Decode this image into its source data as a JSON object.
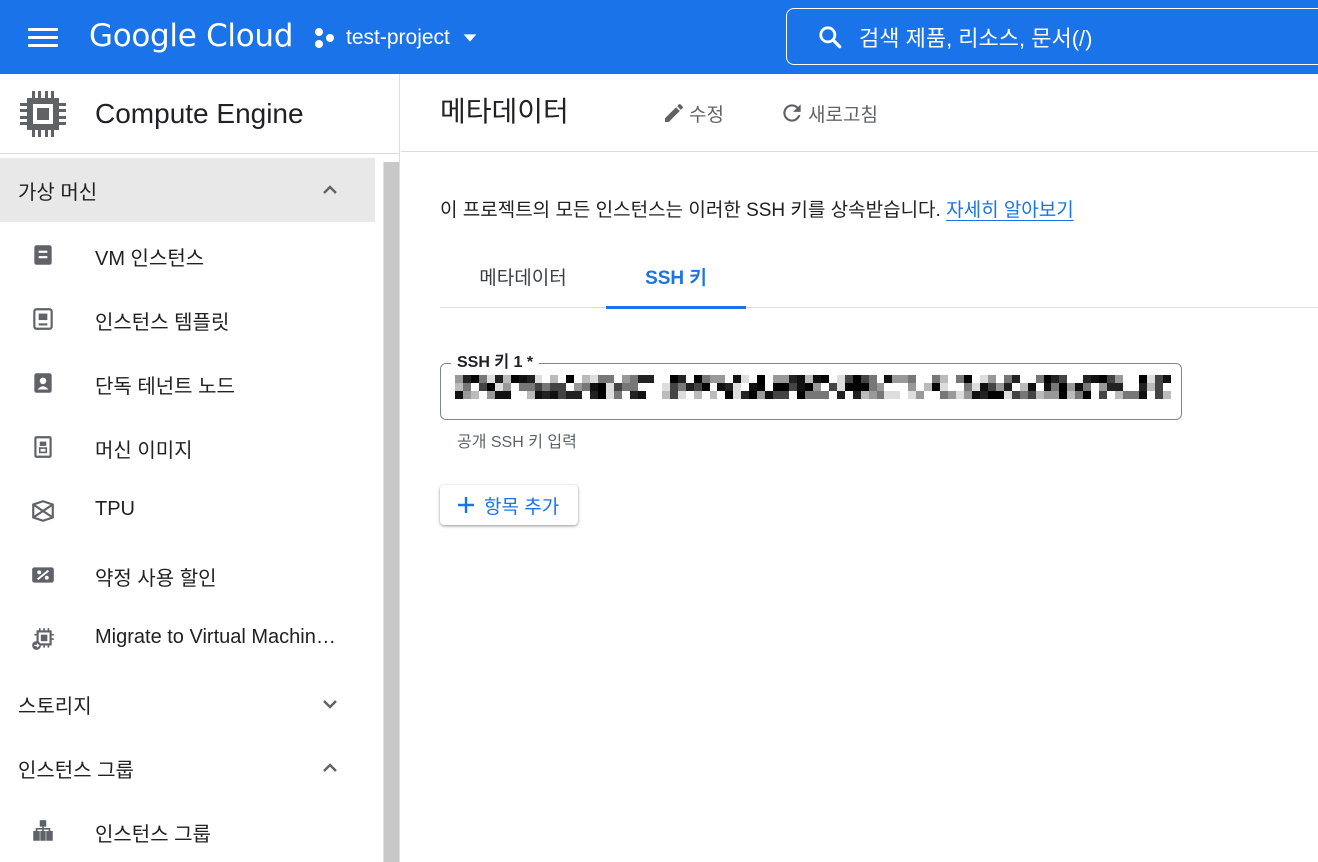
{
  "topbar": {
    "logo_text": "Google Cloud",
    "project_name": "test-project",
    "search_label": "검색   제품, 리소스, 문서(/)"
  },
  "sidebar": {
    "product_title": "Compute Engine",
    "sections": [
      {
        "label": "가상 머신",
        "expanded": true,
        "active": true
      },
      {
        "label": "스토리지",
        "expanded": false
      },
      {
        "label": "인스턴스 그룹",
        "expanded": true
      }
    ],
    "vm_items": [
      {
        "label": "VM 인스턴스",
        "icon": "server-icon"
      },
      {
        "label": "인스턴스 템플릿",
        "icon": "template-icon"
      },
      {
        "label": "단독 테넌트 노드",
        "icon": "tenant-node-icon"
      },
      {
        "label": "머신 이미지",
        "icon": "machine-image-icon"
      },
      {
        "label": "TPU",
        "icon": "tpu-icon"
      },
      {
        "label": "약정 사용 할인",
        "icon": "discount-icon"
      },
      {
        "label": "Migrate to Virtual Machin…",
        "icon": "migrate-icon"
      }
    ],
    "group_items": [
      {
        "label": "인스턴스 그룹",
        "icon": "instance-group-icon"
      }
    ]
  },
  "main": {
    "title": "메타데이터",
    "edit_label": "수정",
    "refresh_label": "새로고침",
    "info_text": "이 프로젝트의 모든 인스턴스는 이러한 SSH 키를 상속받습니다. ",
    "learn_more": "자세히 알아보기",
    "tabs": [
      {
        "label": "메타데이터",
        "active": false
      },
      {
        "label": "SSH 키",
        "active": true
      }
    ],
    "ssh_field": {
      "label": "SSH 키 1 *",
      "helper": "공개 SSH 키 입력"
    },
    "add_item_label": "항목 추가"
  },
  "colors": {
    "brand_blue": "#1a73e8",
    "text": "#202124",
    "secondary_text": "#5f6368",
    "active_nav_bg": "#e8e8e8"
  }
}
